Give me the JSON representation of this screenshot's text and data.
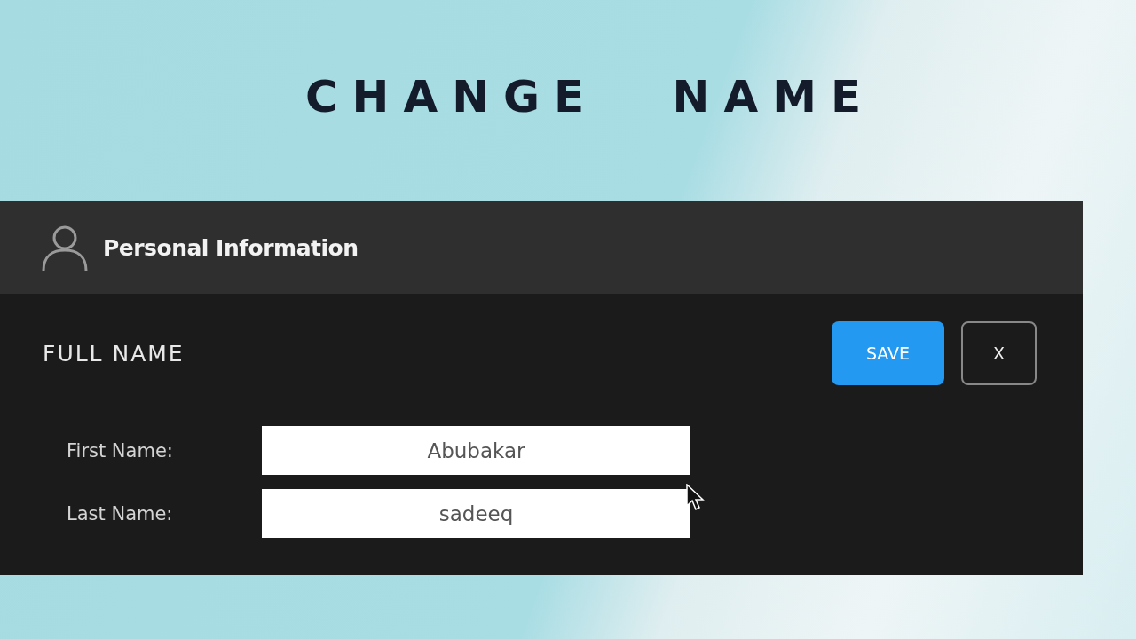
{
  "heading": "CHANGE NAME",
  "panel": {
    "title": "Personal Information",
    "section": "FULL NAME",
    "buttons": [
      {
        "kind": "save",
        "label": "SAVE"
      },
      {
        "kind": "close",
        "label": "X"
      }
    ],
    "fields": [
      {
        "label": "First Name:",
        "value": "Abubakar"
      },
      {
        "label": "Last Name:",
        "value": "sadeeq"
      }
    ]
  }
}
